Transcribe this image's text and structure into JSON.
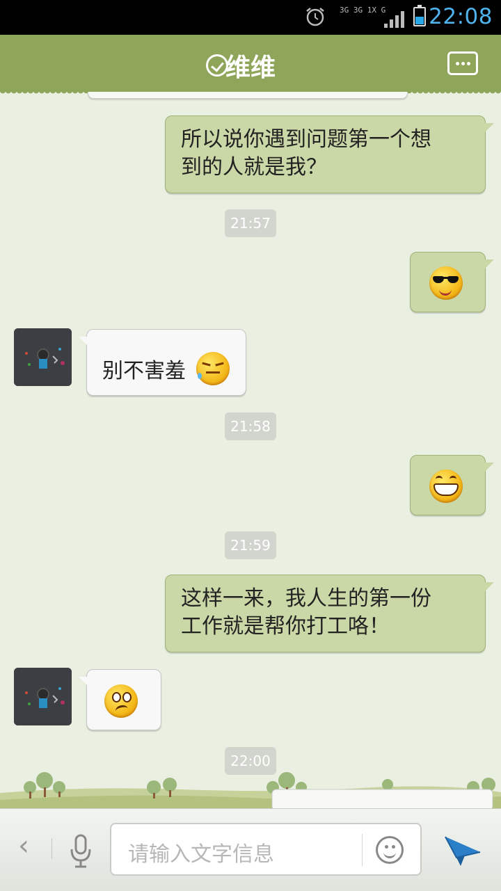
{
  "status_bar": {
    "time": "22:08",
    "network": "3G 3G 1X G"
  },
  "header": {
    "title": "维维",
    "verified_icon": "check-circle-icon",
    "menu_icon": "more-options-icon"
  },
  "messages": [
    {
      "side": "right",
      "text1": "所以说你遇到问题第一个想",
      "text2": "到的人就是我？"
    },
    {
      "timestamp": "21:57"
    },
    {
      "side": "right",
      "emoji": "cool-sunglasses-emoji"
    },
    {
      "side": "left",
      "text": "别不害羞",
      "emoji": "shy-emoji"
    },
    {
      "timestamp": "21:58"
    },
    {
      "side": "right",
      "emoji": "big-grin-emoji"
    },
    {
      "timestamp": "21:59"
    },
    {
      "side": "right",
      "text1": "这样一来，我人生的第一份",
      "text2": "工作就是帮你打工咯！"
    },
    {
      "side": "left",
      "emoji": "confused-emoji"
    },
    {
      "timestamp": "22:00"
    }
  ],
  "input": {
    "placeholder": "请输入文字信息"
  },
  "colors": {
    "header": "#8fa65a",
    "right_bubble": "#c9d8a6",
    "left_bubble": "#f8f8f8",
    "accent": "#4fb3ee",
    "send": "#2b7fc8"
  }
}
